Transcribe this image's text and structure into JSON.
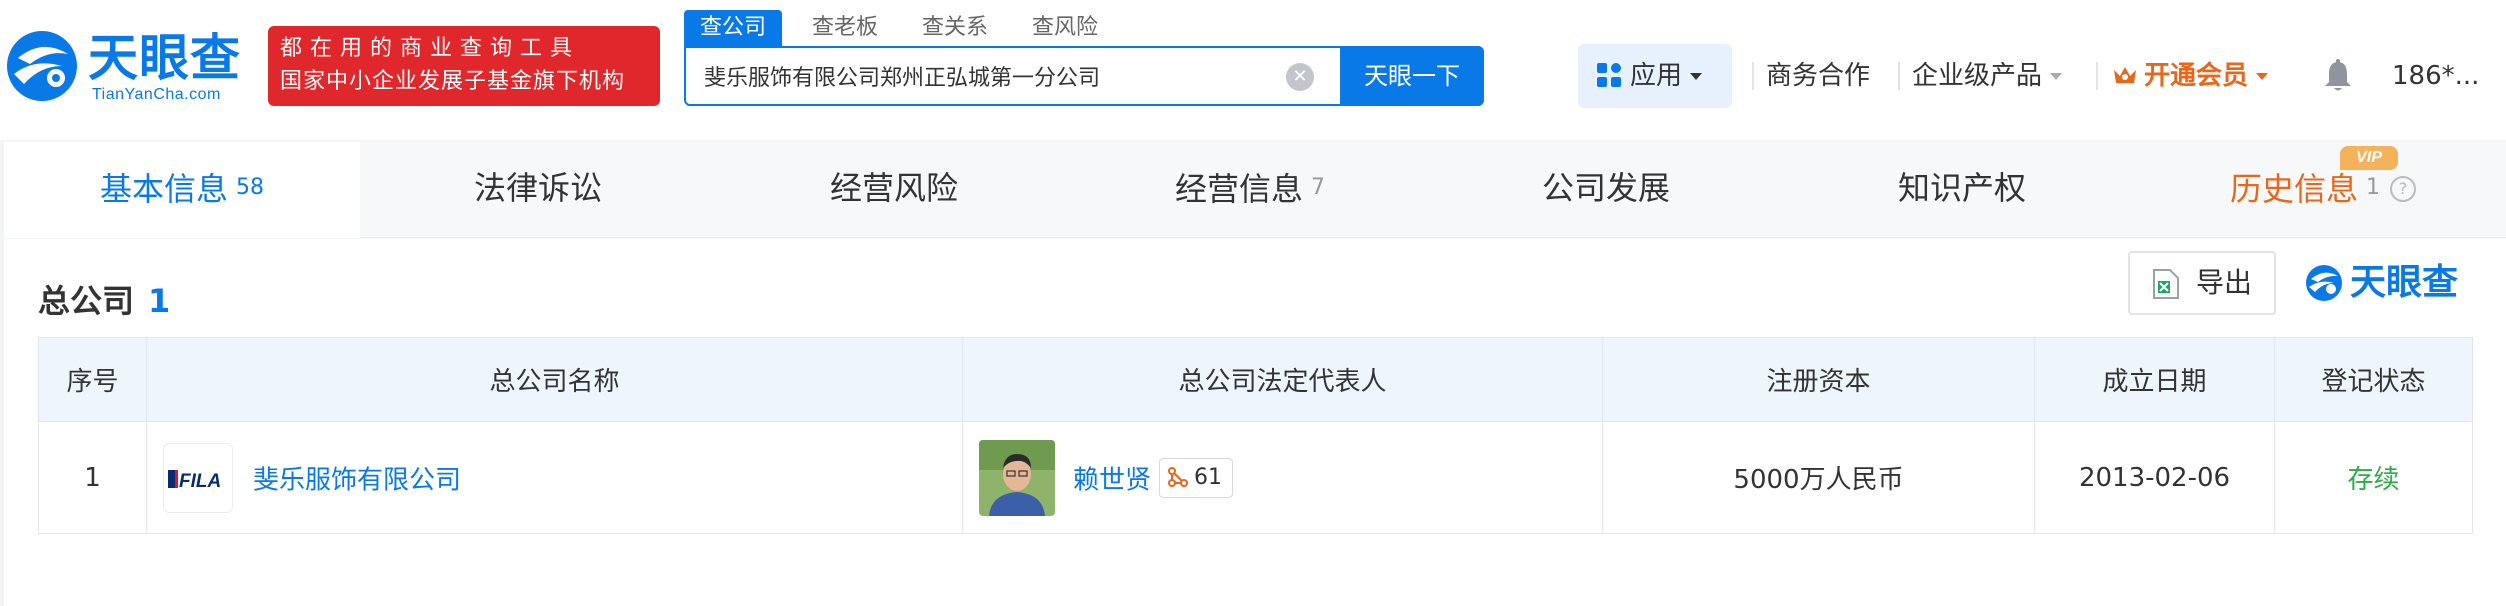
{
  "header": {
    "logo_text": "天眼查",
    "logo_sub": "TianYanCha.com",
    "promo_line1": "都在用的商业查询工具",
    "promo_line2": "国家中小企业发展子基金旗下机构",
    "search_tabs": [
      "查公司",
      "查老板",
      "查关系",
      "查风险"
    ],
    "search_value": "斐乐服饰有限公司郑州正弘城第一分公司",
    "search_button": "天眼一下",
    "apps_label": "应用",
    "nav": {
      "business": "商务合作",
      "enterprise": "企业级产品",
      "vip": "开通会员",
      "user": "186*..."
    }
  },
  "tabs": [
    {
      "label": "基本信息",
      "count": "58"
    },
    {
      "label": "法律诉讼",
      "count": ""
    },
    {
      "label": "经营风险",
      "count": ""
    },
    {
      "label": "经营信息",
      "count": "7"
    },
    {
      "label": "公司发展",
      "count": ""
    },
    {
      "label": "知识产权",
      "count": ""
    },
    {
      "label": "历史信息",
      "count": "1",
      "badge": "VIP"
    }
  ],
  "section": {
    "title": "总公司",
    "count": "1",
    "export_label": "导出",
    "brand": "天眼查"
  },
  "table": {
    "headers": [
      "序号",
      "总公司名称",
      "总公司法定代表人",
      "注册资本",
      "成立日期",
      "登记状态"
    ],
    "rows": [
      {
        "index": "1",
        "logo_text": "FILA",
        "company": "斐乐服饰有限公司",
        "rep": "赖世贤",
        "rep_relations": "61",
        "capital": "5000万人民币",
        "date": "2013-02-06",
        "status": "存续"
      }
    ]
  },
  "colors": {
    "brand_blue": "#0a79e8",
    "promo_red": "#e0272b",
    "vip_orange": "#e8671b",
    "status_green": "#2eaa48"
  }
}
